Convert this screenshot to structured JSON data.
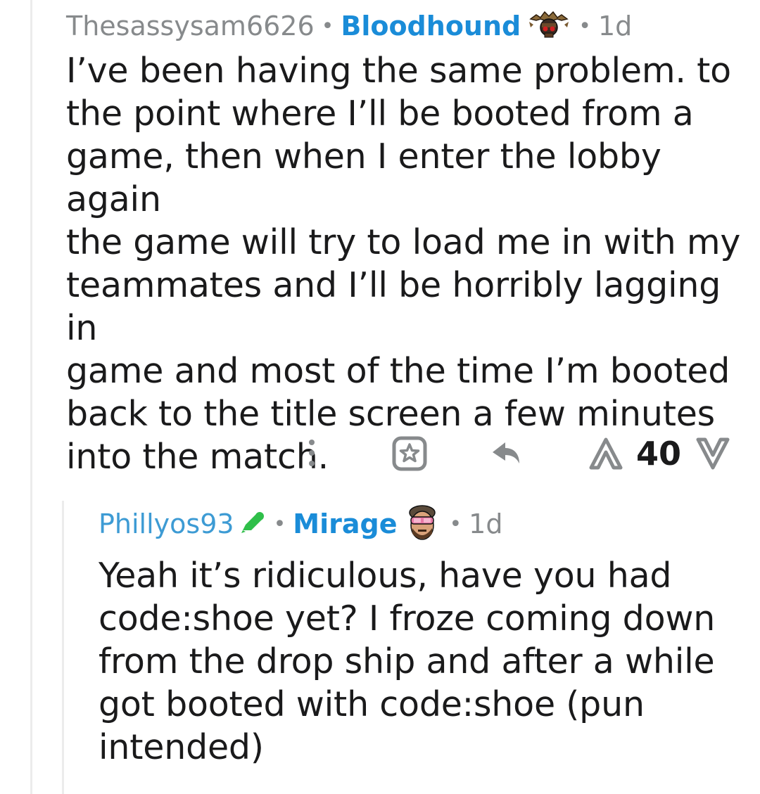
{
  "parent_comment": {
    "author": "Thesassysam6626",
    "separator": "•",
    "flair": "Bloodhound",
    "flair_icon": "bloodhound-avatar-icon",
    "age": "1d",
    "body_lines": [
      "I’ve been having the same problem. to",
      "the point where I’ll be booted from a",
      "game, then when I enter the lobby again",
      "the game will try to load me in with my",
      "teammates and I’ll be horribly lagging in",
      "game and most of the time I’m booted",
      "back to the title screen a few minutes",
      "into the match."
    ],
    "actions": {
      "more_icon": "more-vertical-icon",
      "award_icon": "award-icon",
      "reply_icon": "reply-icon",
      "upvote_icon": "upvote-icon",
      "score": "40",
      "downvote_icon": "downvote-icon"
    }
  },
  "reply_comment": {
    "author": "Phillyos93",
    "author_badge_icon": "pen-icon",
    "separator": "•",
    "flair": "Mirage",
    "flair_icon": "mirage-avatar-icon",
    "age": "1d",
    "body_lines": [
      "Yeah it’s ridiculous, have you had",
      "code:shoe yet? I froze coming down",
      "from the drop ship and after a while",
      "got booted with code:shoe (pun",
      "intended)"
    ]
  },
  "colors": {
    "meta_gray": "#878a8c",
    "flair_blue": "#1a8cd8",
    "author_blue": "#3d9bd4",
    "text": "#1a1a1b",
    "thread_line": "#ececec",
    "action_gray": "#878a8c"
  }
}
